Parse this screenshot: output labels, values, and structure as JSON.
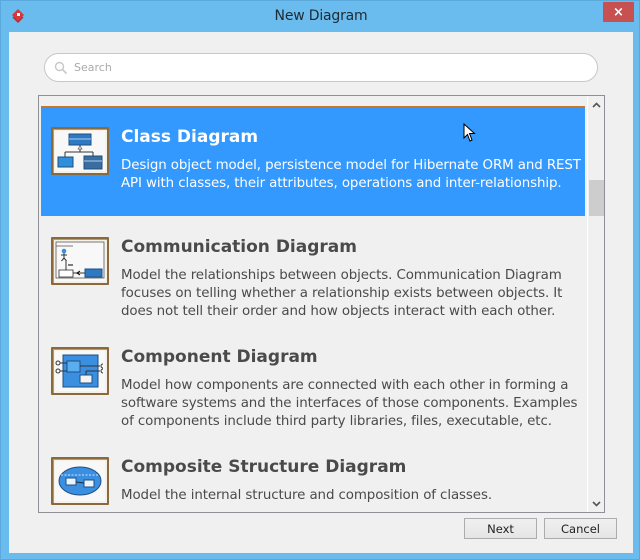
{
  "window": {
    "title": "New Diagram",
    "close_label": "×",
    "app_icon": "visual-paradigm-icon"
  },
  "search": {
    "placeholder": "Search",
    "value": ""
  },
  "diagram_list": {
    "selected_index": 0,
    "items": [
      {
        "title": "Class Diagram",
        "description": "Design object model, persistence model for Hibernate ORM and REST API with classes, their attributes, operations and inter-relationship.",
        "icon": "class-diagram-icon"
      },
      {
        "title": "Communication Diagram",
        "description": "Model the relationships between objects. Communication Diagram focuses on telling whether a relationship exists between objects. It does not tell their order and how objects interact with each other.",
        "icon": "communication-diagram-icon"
      },
      {
        "title": "Component Diagram",
        "description": "Model how components are connected with each other in forming a software systems and the interfaces of those components. Examples of components include third party libraries, files, executable, etc.",
        "icon": "component-diagram-icon"
      },
      {
        "title": "Composite Structure Diagram",
        "description": "Model the internal structure and composition of classes.",
        "icon": "composite-structure-diagram-icon"
      }
    ]
  },
  "scrollbar": {
    "up_glyph": "⌃",
    "down_glyph": "⌄"
  },
  "buttons": {
    "next": "Next",
    "cancel": "Cancel"
  },
  "colors": {
    "titlebar": "#6abcee",
    "selection": "#3399ff",
    "close": "#c75050"
  }
}
